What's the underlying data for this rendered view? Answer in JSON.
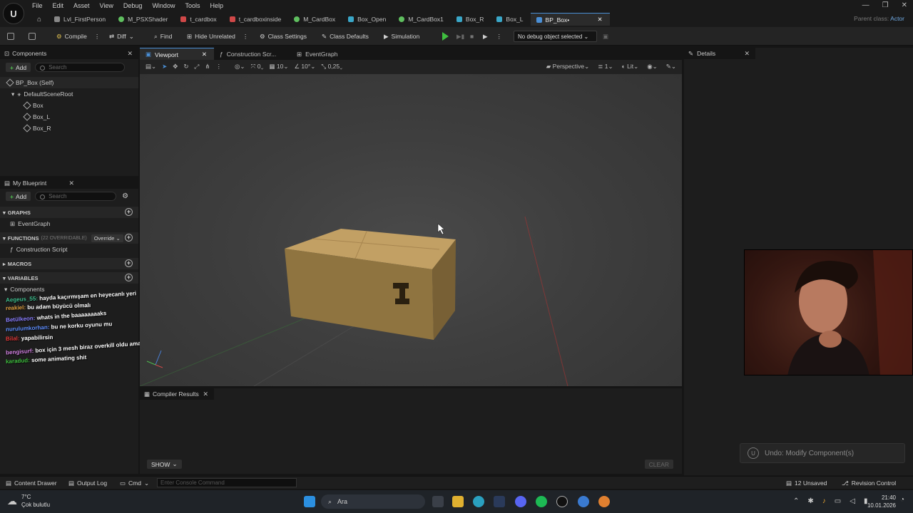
{
  "menu": [
    "File",
    "Edit",
    "Asset",
    "View",
    "Debug",
    "Window",
    "Tools",
    "Help"
  ],
  "tabs": [
    {
      "label": "Lvl_FirstPerson",
      "color": "#888888"
    },
    {
      "label": "M_PSXShader",
      "color": "#5fbf5f"
    },
    {
      "label": "t_cardbox",
      "color": "#d04848"
    },
    {
      "label": "t_cardboxinside",
      "color": "#d04848"
    },
    {
      "label": "M_CardBox",
      "color": "#5fbf5f"
    },
    {
      "label": "Box_Open",
      "color": "#3aa7c8"
    },
    {
      "label": "M_CardBox1",
      "color": "#5fbf5f"
    },
    {
      "label": "Box_R",
      "color": "#3aa7c8"
    },
    {
      "label": "Box_L",
      "color": "#3aa7c8"
    },
    {
      "label": "BP_Box•",
      "color": "#4a8fd6"
    }
  ],
  "parent_class": {
    "label": "Parent class:",
    "value": "Actor"
  },
  "toolbar": {
    "compile": "Compile",
    "diff": "Diff",
    "find": "Find",
    "hide_unrelated": "Hide Unrelated",
    "class_settings": "Class Settings",
    "class_defaults": "Class Defaults",
    "simulation": "Simulation",
    "debug_object": "No debug object selected"
  },
  "components_panel": {
    "title": "Components",
    "add": "Add",
    "search_placeholder": "Search",
    "tree": [
      "BP_Box (Self)",
      "DefaultSceneRoot",
      "Box",
      "Box_L",
      "Box_R"
    ]
  },
  "my_blueprint": {
    "title": "My Blueprint",
    "add": "Add",
    "search_placeholder": "Search",
    "graphs": "GRAPHS",
    "event_graph": "EventGraph",
    "functions": "FUNCTIONS",
    "functions_note": "(22 OVERRIDABLE)",
    "override": "Override",
    "construction_script": "Construction Script",
    "macros": "MACROS",
    "variables": "VARIABLES",
    "components": "Components"
  },
  "chat": [
    {
      "user": "Aegeus_55:",
      "msg": "hayda kaçırmışam en heyecanlı yeri",
      "color": "#3fbf8f"
    },
    {
      "user": "reakiel:",
      "msg": "bu adam büyücü olmalı",
      "color": "#e0a040"
    },
    {
      "user": "Betülkeon:",
      "msg": "whats in the baaaaaaaaks",
      "color": "#8a7fff"
    },
    {
      "user": "nurulumkorhan:",
      "msg": "bu ne korku oyunu mu",
      "color": "#5f8fff"
    },
    {
      "user": "Bilal:",
      "msg": "yapabilirsin",
      "color": "#e03a3a"
    },
    {
      "user": "bengisurf:",
      "msg": "box için 3 mesh biraz overkill oldu ama",
      "color": "#d080e0"
    },
    {
      "user": "karadud:",
      "msg": "some animating shit",
      "color": "#3fbf3f"
    }
  ],
  "viewport_tabs": [
    "Viewport",
    "Construction Scr...",
    "EventGraph"
  ],
  "viewport_tools": {
    "snap_angle": "10°",
    "snap_grid": "10",
    "scale": "0,25",
    "zero": "0",
    "perspective": "Perspective",
    "lit": "Lit",
    "cam_speed": "1"
  },
  "details": {
    "title": "Details"
  },
  "compiler": {
    "title": "Compiler Results",
    "show": "SHOW",
    "clear": "CLEAR"
  },
  "toast": "Undo: Modify Component(s)",
  "statusbar": {
    "content_drawer": "Content Drawer",
    "output_log": "Output Log",
    "cmd": "Cmd",
    "console_placeholder": "Enter Console Command",
    "unsaved": "12 Unsaved",
    "revision": "Revision Control"
  },
  "taskbar": {
    "temp": "7°C",
    "weather": "Çok bulutlu",
    "search": "Ara",
    "time": "21:40",
    "date": "10.01.2026"
  }
}
